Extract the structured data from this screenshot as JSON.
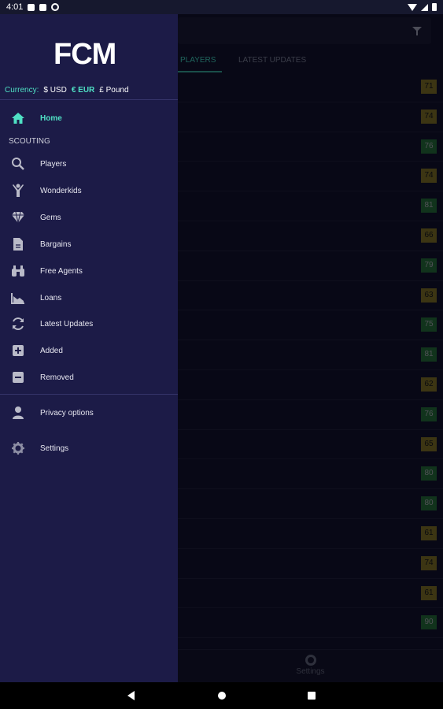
{
  "status_bar": {
    "time": "4:01"
  },
  "background_app": {
    "tabs": [
      {
        "label": "PLAYERS",
        "active": true
      },
      {
        "label": "LATEST UPDATES",
        "active": false
      }
    ],
    "ratings": [
      {
        "value": "71",
        "color": "yellow"
      },
      {
        "value": "74",
        "color": "yellow"
      },
      {
        "value": "76",
        "color": "green"
      },
      {
        "value": "74",
        "color": "yellow"
      },
      {
        "value": "81",
        "color": "green"
      },
      {
        "value": "66",
        "color": "yellow"
      },
      {
        "value": "79",
        "color": "green"
      },
      {
        "value": "63",
        "color": "yellow"
      },
      {
        "value": "75",
        "color": "green"
      },
      {
        "value": "81",
        "color": "green"
      },
      {
        "value": "62",
        "color": "yellow"
      },
      {
        "value": "76",
        "color": "green"
      },
      {
        "value": "65",
        "color": "yellow"
      },
      {
        "value": "80",
        "color": "green"
      },
      {
        "value": "80",
        "color": "green"
      },
      {
        "value": "61",
        "color": "yellow"
      },
      {
        "value": "74",
        "color": "yellow"
      },
      {
        "value": "61",
        "color": "yellow"
      },
      {
        "value": "90",
        "color": "green"
      }
    ],
    "bottom_nav_label": "Settings"
  },
  "drawer": {
    "logo": "FCM",
    "currency": {
      "label": "Currency:",
      "usd": "$ USD",
      "eur": "€ EUR",
      "pound": "£ Pound"
    },
    "home": "Home",
    "section_title": "SCOUTING",
    "items": [
      {
        "label": "Players",
        "icon": "search-icon"
      },
      {
        "label": "Wonderkids",
        "icon": "child-icon"
      },
      {
        "label": "Gems",
        "icon": "diamond-icon"
      },
      {
        "label": "Bargains",
        "icon": "document-icon"
      },
      {
        "label": "Free Agents",
        "icon": "binoculars-icon"
      },
      {
        "label": "Loans",
        "icon": "chart-icon"
      },
      {
        "label": "Latest Updates",
        "icon": "refresh-icon"
      },
      {
        "label": "Added",
        "icon": "plus-box-icon"
      },
      {
        "label": "Removed",
        "icon": "minus-box-icon"
      }
    ],
    "privacy": "Privacy options",
    "settings": "Settings"
  },
  "colors": {
    "accent": "#4fe0c4",
    "drawer_bg": "#1c1b47",
    "rating_yellow": "#b9a521",
    "rating_green": "#2d9e3c"
  }
}
